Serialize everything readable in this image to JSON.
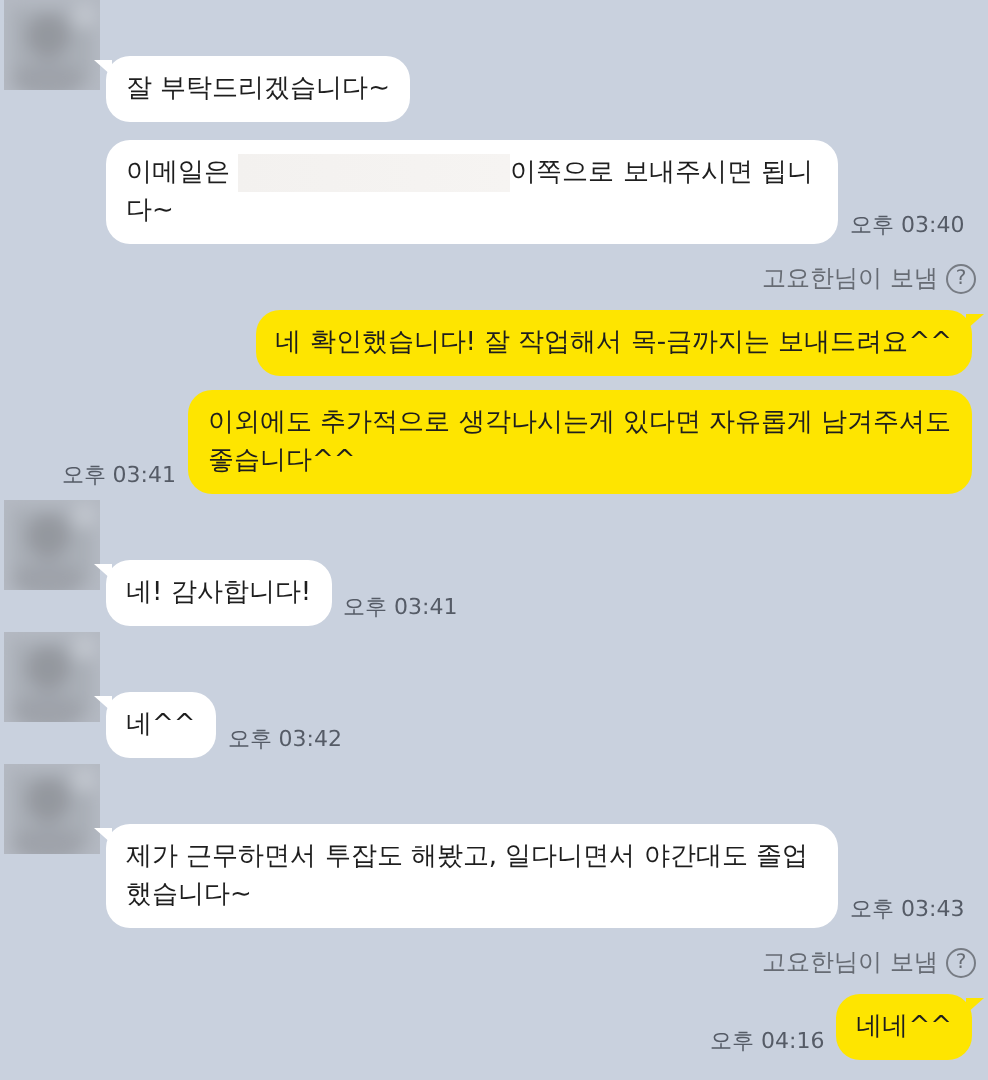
{
  "messages": [
    {
      "kind": "received",
      "avatar": true,
      "tail": true,
      "parts": [
        {
          "kind": "text",
          "text": "잘 부탁드리겠습니다~"
        }
      ]
    },
    {
      "kind": "received",
      "avatar": false,
      "tail": false,
      "parts": [
        {
          "kind": "text",
          "text": "이메일은 "
        },
        {
          "kind": "redacted"
        },
        {
          "kind": "text",
          "text": "이쪽으로 보내주시면 됩니다~"
        }
      ],
      "time": "오후 03:40"
    },
    {
      "kind": "sender_note",
      "text": "고요한님이 보냄",
      "icon": "?"
    },
    {
      "kind": "sent",
      "tail": true,
      "parts": [
        {
          "kind": "text",
          "text": "네 확인했습니다! 잘 작업해서 목-금까지는 보내드려요^^"
        }
      ]
    },
    {
      "kind": "sent",
      "tail": false,
      "parts": [
        {
          "kind": "text",
          "text": "이외에도 추가적으로 생각나시는게 있다면 자유롭게 남겨주셔도 좋습니다^^"
        }
      ],
      "time": "오후 03:41"
    },
    {
      "kind": "received",
      "avatar": true,
      "tail": true,
      "parts": [
        {
          "kind": "text",
          "text": "네! 감사합니다!"
        }
      ],
      "time": "오후 03:41"
    },
    {
      "kind": "received",
      "avatar": true,
      "tail": true,
      "parts": [
        {
          "kind": "text",
          "text": "네^^"
        }
      ],
      "time": "오후 03:42"
    },
    {
      "kind": "received",
      "avatar": true,
      "tail": true,
      "parts": [
        {
          "kind": "text",
          "text": "제가 근무하면서 투잡도 해봤고, 일다니면서 야간대도 졸업했습니다~"
        }
      ],
      "time": "오후 03:43"
    },
    {
      "kind": "sender_note",
      "text": "고요한님이 보냄",
      "icon": "?"
    },
    {
      "kind": "sent",
      "tail": true,
      "parts": [
        {
          "kind": "text",
          "text": "네네^^"
        }
      ],
      "time": "오후 04:16"
    }
  ]
}
